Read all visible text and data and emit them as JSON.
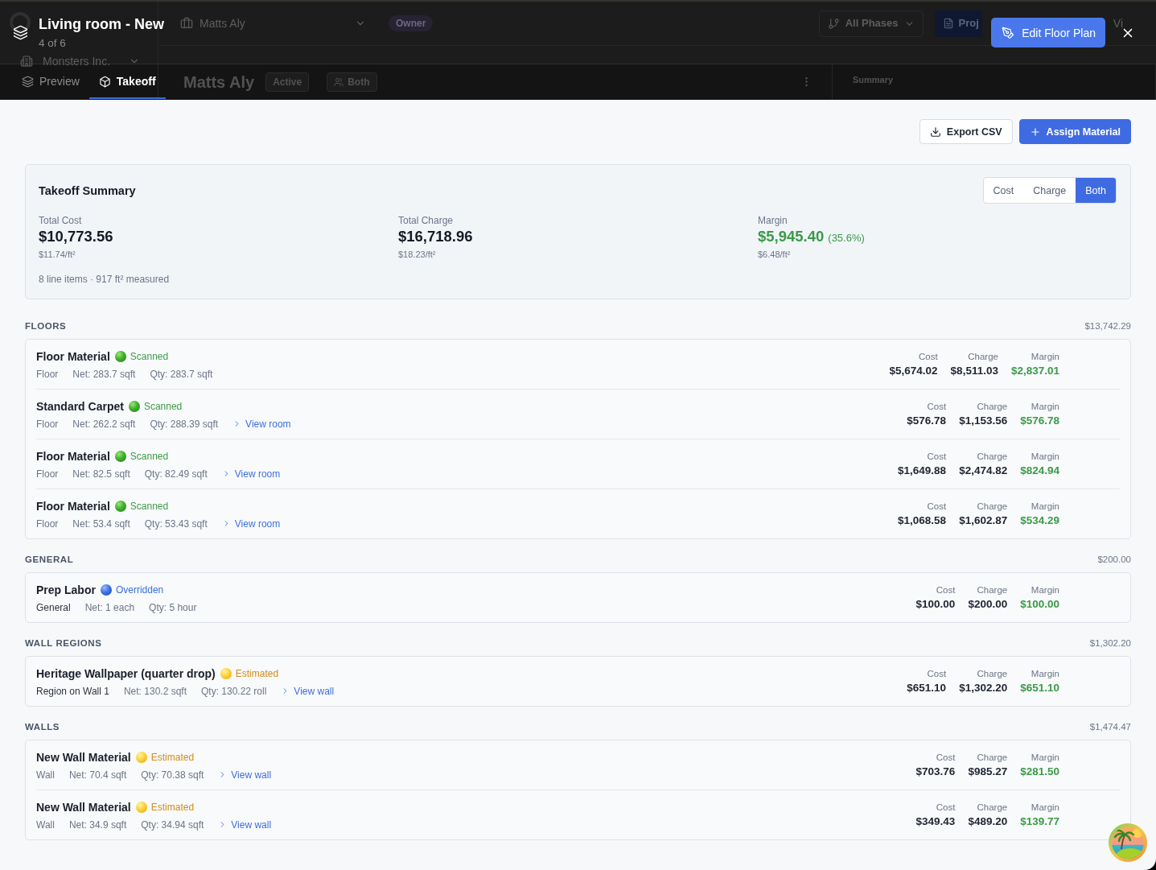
{
  "backdrop": {
    "workspace": "Monsters Inc.",
    "client": "Matts Aly",
    "role_badge": "Owner",
    "phase_filter": "All Phases",
    "primary_button": "Proj",
    "view_button": "Vi",
    "heading": "Matts Aly",
    "status_badge": "Active",
    "type_badge": "Both",
    "panel_title": "Summary"
  },
  "modal": {
    "title": "Living room - New",
    "counter": "4 of 6",
    "edit_button": "Edit Floor Plan"
  },
  "tabs": [
    {
      "label": "Preview",
      "selected": false
    },
    {
      "label": "Takeoff",
      "selected": true
    }
  ],
  "actions": [
    {
      "label": "Export CSV",
      "kind": "secondary"
    },
    {
      "label": "Assign Material",
      "kind": "primary"
    }
  ],
  "summary": {
    "title": "Takeoff Summary",
    "modes": [
      {
        "label": "Cost",
        "selected": false
      },
      {
        "label": "Charge",
        "selected": false
      },
      {
        "label": "Both",
        "selected": true
      }
    ],
    "stats": [
      {
        "label": "Total Cost",
        "value": "$10,773.56",
        "rate": "$11.74/ft²",
        "kind": "neutral"
      },
      {
        "label": "Total Charge",
        "value": "$16,718.96",
        "rate": "$18.23/ft²",
        "kind": "neutral"
      },
      {
        "label": "Margin",
        "value": "$5,945.40",
        "percent": "(35.6%)",
        "rate": "$6.48/ft²",
        "kind": "margin"
      }
    ],
    "footer": "8 line items · 917 ft² measured"
  },
  "sections": [
    {
      "title": "FLOORS",
      "total": "$13,742.29",
      "items": [
        {
          "name": "Floor Material",
          "status": {
            "label": "Scanned",
            "kind": "scanned"
          },
          "type": "Floor",
          "type_emphasized": false,
          "net": "Net: 283.7 sqft",
          "qty": "Qty: 283.7 sqft",
          "amounts": [
            {
              "label": "Cost",
              "value": "$5,674.02",
              "kind": "cost"
            },
            {
              "label": "Charge",
              "value": "$8,511.03",
              "kind": "charge"
            },
            {
              "label": "Margin",
              "value": "$2,837.01",
              "kind": "margin"
            }
          ]
        },
        {
          "name": "Standard Carpet",
          "status": {
            "label": "Scanned",
            "kind": "scanned"
          },
          "type": "Floor",
          "type_emphasized": false,
          "net": "Net: 262.2 sqft",
          "qty": "Qty: 288.39 sqft",
          "link": "View room",
          "amounts": [
            {
              "label": "Cost",
              "value": "$576.78",
              "kind": "cost"
            },
            {
              "label": "Charge",
              "value": "$1,153.56",
              "kind": "charge"
            },
            {
              "label": "Margin",
              "value": "$576.78",
              "kind": "margin"
            }
          ]
        },
        {
          "name": "Floor Material",
          "status": {
            "label": "Scanned",
            "kind": "scanned"
          },
          "type": "Floor",
          "type_emphasized": false,
          "net": "Net: 82.5 sqft",
          "qty": "Qty: 82.49 sqft",
          "link": "View room",
          "amounts": [
            {
              "label": "Cost",
              "value": "$1,649.88",
              "kind": "cost"
            },
            {
              "label": "Charge",
              "value": "$2,474.82",
              "kind": "charge"
            },
            {
              "label": "Margin",
              "value": "$824.94",
              "kind": "margin"
            }
          ]
        },
        {
          "name": "Floor Material",
          "status": {
            "label": "Scanned",
            "kind": "scanned"
          },
          "type": "Floor",
          "type_emphasized": false,
          "net": "Net: 53.4 sqft",
          "qty": "Qty: 53.43 sqft",
          "link": "View room",
          "amounts": [
            {
              "label": "Cost",
              "value": "$1,068.58",
              "kind": "cost"
            },
            {
              "label": "Charge",
              "value": "$1,602.87",
              "kind": "charge"
            },
            {
              "label": "Margin",
              "value": "$534.29",
              "kind": "margin"
            }
          ]
        }
      ]
    },
    {
      "title": "GENERAL",
      "total": "$200.00",
      "items": [
        {
          "name": "Prep Labor",
          "status": {
            "label": "Overridden",
            "kind": "overridden"
          },
          "type": "General",
          "type_emphasized": true,
          "net": "Net: 1 each",
          "qty": "Qty: 5 hour",
          "amounts": [
            {
              "label": "Cost",
              "value": "$100.00",
              "kind": "cost"
            },
            {
              "label": "Charge",
              "value": "$200.00",
              "kind": "charge"
            },
            {
              "label": "Margin",
              "value": "$100.00",
              "kind": "margin"
            }
          ]
        }
      ]
    },
    {
      "title": "WALL REGIONS",
      "total": "$1,302.20",
      "items": [
        {
          "name": "Heritage Wallpaper (quarter drop)",
          "status": {
            "label": "Estimated",
            "kind": "estimated"
          },
          "type": "Region on Wall 1",
          "type_emphasized": true,
          "net": "Net: 130.2 sqft",
          "qty": "Qty: 130.22 roll",
          "link": "View wall",
          "amounts": [
            {
              "label": "Cost",
              "value": "$651.10",
              "kind": "cost"
            },
            {
              "label": "Charge",
              "value": "$1,302.20",
              "kind": "charge"
            },
            {
              "label": "Margin",
              "value": "$651.10",
              "kind": "margin"
            }
          ]
        }
      ]
    },
    {
      "title": "WALLS",
      "total": "$1,474.47",
      "items": [
        {
          "name": "New Wall Material",
          "status": {
            "label": "Estimated",
            "kind": "estimated"
          },
          "type": "Wall",
          "type_emphasized": false,
          "net": "Net: 70.4 sqft",
          "qty": "Qty: 70.38 sqft",
          "link": "View wall",
          "amounts": [
            {
              "label": "Cost",
              "value": "$703.76",
              "kind": "cost"
            },
            {
              "label": "Charge",
              "value": "$985.27",
              "kind": "charge"
            },
            {
              "label": "Margin",
              "value": "$281.50",
              "kind": "margin"
            }
          ]
        },
        {
          "name": "New Wall Material",
          "status": {
            "label": "Estimated",
            "kind": "estimated"
          },
          "type": "Wall",
          "type_emphasized": false,
          "net": "Net: 34.9 sqft",
          "qty": "Qty: 34.94 sqft",
          "link": "View wall",
          "amounts": [
            {
              "label": "Cost",
              "value": "$349.43",
              "kind": "cost"
            },
            {
              "label": "Charge",
              "value": "$489.20",
              "kind": "charge"
            },
            {
              "label": "Margin",
              "value": "$139.77",
              "kind": "margin"
            }
          ]
        }
      ]
    }
  ]
}
